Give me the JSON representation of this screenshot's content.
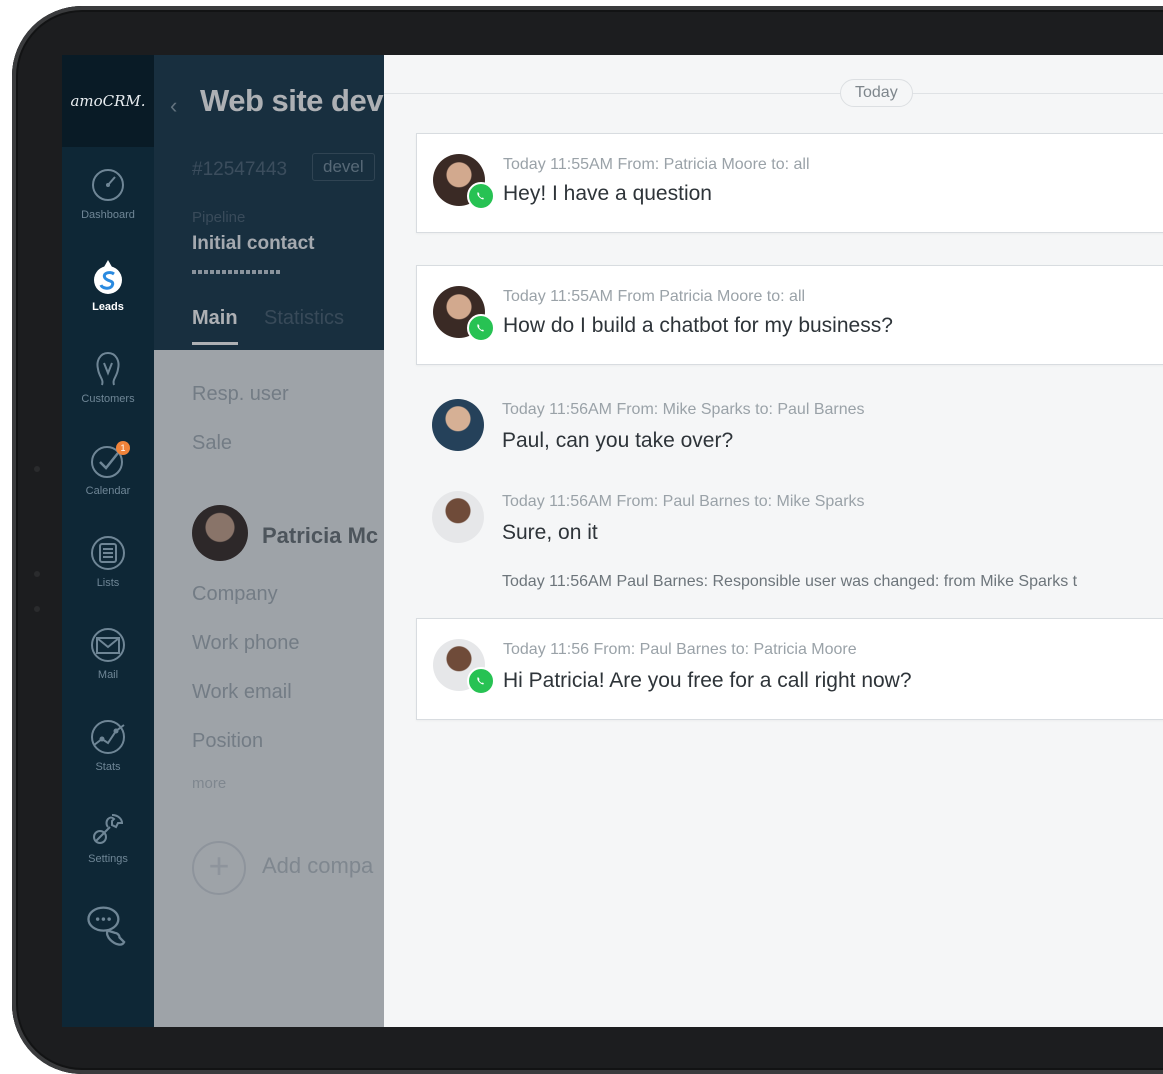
{
  "sidebar": {
    "logo": "amoCRM.",
    "items": [
      {
        "label": "Dashboard",
        "icon": "dashboard-icon"
      },
      {
        "label": "Leads",
        "icon": "leads-icon",
        "active": true
      },
      {
        "label": "Customers",
        "icon": "customers-icon"
      },
      {
        "label": "Calendar",
        "icon": "calendar-icon",
        "badge": "1"
      },
      {
        "label": "Lists",
        "icon": "lists-icon"
      },
      {
        "label": "Mail",
        "icon": "mail-icon"
      },
      {
        "label": "Stats",
        "icon": "stats-icon"
      },
      {
        "label": "Settings",
        "icon": "settings-icon"
      }
    ]
  },
  "lead": {
    "title": "Web site deve",
    "id": "#12547443",
    "tag": "devel",
    "pipeline_label": "Pipeline",
    "pipeline_value": "Initial contact",
    "tabs": [
      "Main",
      "Statistics"
    ],
    "fields": [
      "Resp. user",
      "Sale"
    ],
    "contact_name": "Patricia Mc",
    "contact_fields": [
      "Company",
      "Work phone",
      "Work email",
      "Position"
    ],
    "more": "more",
    "add_company": "Add compa"
  },
  "chat": {
    "day": "Today",
    "messages": [
      {
        "meta": "Today 11:55AM From: Patricia Moore to: all",
        "text": "Hey! I have a question",
        "sender": "patricia",
        "whatsapp": true,
        "card": true
      },
      {
        "meta": "Today 11:55AM From Patricia Moore to: all",
        "text": "How do I build a chatbot for my business?",
        "sender": "patricia",
        "whatsapp": true,
        "card": true
      },
      {
        "meta": "Today 11:56AM From: Mike Sparks to: Paul Barnes",
        "text": "Paul, can you take over?",
        "sender": "mike",
        "whatsapp": false,
        "card": false
      },
      {
        "meta": "Today 11:56AM From: Paul Barnes to: Mike Sparks",
        "text": "Sure, on it",
        "sender": "paul",
        "whatsapp": false,
        "card": false
      },
      {
        "meta": "Today 11:56 From: Paul Barnes to: Patricia Moore",
        "text": "Hi Patricia! Are you free for a call right now?",
        "sender": "paul",
        "whatsapp": true,
        "card": true
      }
    ],
    "system_note": "Today 11:56AM Paul Barnes: Responsible user was changed: from Mike Sparks t"
  },
  "colors": {
    "sidebar": "#0e2736",
    "lead_header": "#1b3a4c",
    "whatsapp": "#27c253",
    "badge": "#f0833a"
  }
}
